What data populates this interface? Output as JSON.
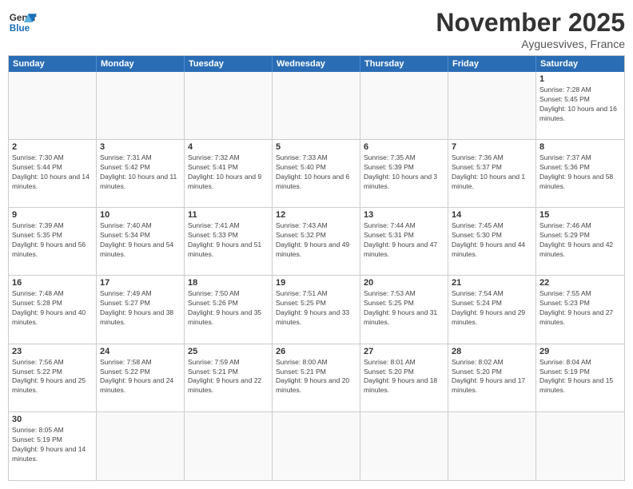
{
  "header": {
    "logo_general": "General",
    "logo_blue": "Blue",
    "month_title": "November 2025",
    "location": "Ayguesvives, France"
  },
  "day_headers": [
    "Sunday",
    "Monday",
    "Tuesday",
    "Wednesday",
    "Thursday",
    "Friday",
    "Saturday"
  ],
  "weeks": [
    [
      {
        "date": "",
        "info": ""
      },
      {
        "date": "",
        "info": ""
      },
      {
        "date": "",
        "info": ""
      },
      {
        "date": "",
        "info": ""
      },
      {
        "date": "",
        "info": ""
      },
      {
        "date": "",
        "info": ""
      },
      {
        "date": "1",
        "info": "Sunrise: 7:28 AM\nSunset: 5:45 PM\nDaylight: 10 hours and 16 minutes."
      }
    ],
    [
      {
        "date": "2",
        "info": "Sunrise: 7:30 AM\nSunset: 5:44 PM\nDaylight: 10 hours and 14 minutes."
      },
      {
        "date": "3",
        "info": "Sunrise: 7:31 AM\nSunset: 5:42 PM\nDaylight: 10 hours and 11 minutes."
      },
      {
        "date": "4",
        "info": "Sunrise: 7:32 AM\nSunset: 5:41 PM\nDaylight: 10 hours and 9 minutes."
      },
      {
        "date": "5",
        "info": "Sunrise: 7:33 AM\nSunset: 5:40 PM\nDaylight: 10 hours and 6 minutes."
      },
      {
        "date": "6",
        "info": "Sunrise: 7:35 AM\nSunset: 5:39 PM\nDaylight: 10 hours and 3 minutes."
      },
      {
        "date": "7",
        "info": "Sunrise: 7:36 AM\nSunset: 5:37 PM\nDaylight: 10 hours and 1 minute."
      },
      {
        "date": "8",
        "info": "Sunrise: 7:37 AM\nSunset: 5:36 PM\nDaylight: 9 hours and 58 minutes."
      }
    ],
    [
      {
        "date": "9",
        "info": "Sunrise: 7:39 AM\nSunset: 5:35 PM\nDaylight: 9 hours and 56 minutes."
      },
      {
        "date": "10",
        "info": "Sunrise: 7:40 AM\nSunset: 5:34 PM\nDaylight: 9 hours and 54 minutes."
      },
      {
        "date": "11",
        "info": "Sunrise: 7:41 AM\nSunset: 5:33 PM\nDaylight: 9 hours and 51 minutes."
      },
      {
        "date": "12",
        "info": "Sunrise: 7:43 AM\nSunset: 5:32 PM\nDaylight: 9 hours and 49 minutes."
      },
      {
        "date": "13",
        "info": "Sunrise: 7:44 AM\nSunset: 5:31 PM\nDaylight: 9 hours and 47 minutes."
      },
      {
        "date": "14",
        "info": "Sunrise: 7:45 AM\nSunset: 5:30 PM\nDaylight: 9 hours and 44 minutes."
      },
      {
        "date": "15",
        "info": "Sunrise: 7:46 AM\nSunset: 5:29 PM\nDaylight: 9 hours and 42 minutes."
      }
    ],
    [
      {
        "date": "16",
        "info": "Sunrise: 7:48 AM\nSunset: 5:28 PM\nDaylight: 9 hours and 40 minutes."
      },
      {
        "date": "17",
        "info": "Sunrise: 7:49 AM\nSunset: 5:27 PM\nDaylight: 9 hours and 38 minutes."
      },
      {
        "date": "18",
        "info": "Sunrise: 7:50 AM\nSunset: 5:26 PM\nDaylight: 9 hours and 35 minutes."
      },
      {
        "date": "19",
        "info": "Sunrise: 7:51 AM\nSunset: 5:25 PM\nDaylight: 9 hours and 33 minutes."
      },
      {
        "date": "20",
        "info": "Sunrise: 7:53 AM\nSunset: 5:25 PM\nDaylight: 9 hours and 31 minutes."
      },
      {
        "date": "21",
        "info": "Sunrise: 7:54 AM\nSunset: 5:24 PM\nDaylight: 9 hours and 29 minutes."
      },
      {
        "date": "22",
        "info": "Sunrise: 7:55 AM\nSunset: 5:23 PM\nDaylight: 9 hours and 27 minutes."
      }
    ],
    [
      {
        "date": "23",
        "info": "Sunrise: 7:56 AM\nSunset: 5:22 PM\nDaylight: 9 hours and 25 minutes."
      },
      {
        "date": "24",
        "info": "Sunrise: 7:58 AM\nSunset: 5:22 PM\nDaylight: 9 hours and 24 minutes."
      },
      {
        "date": "25",
        "info": "Sunrise: 7:59 AM\nSunset: 5:21 PM\nDaylight: 9 hours and 22 minutes."
      },
      {
        "date": "26",
        "info": "Sunrise: 8:00 AM\nSunset: 5:21 PM\nDaylight: 9 hours and 20 minutes."
      },
      {
        "date": "27",
        "info": "Sunrise: 8:01 AM\nSunset: 5:20 PM\nDaylight: 9 hours and 18 minutes."
      },
      {
        "date": "28",
        "info": "Sunrise: 8:02 AM\nSunset: 5:20 PM\nDaylight: 9 hours and 17 minutes."
      },
      {
        "date": "29",
        "info": "Sunrise: 8:04 AM\nSunset: 5:19 PM\nDaylight: 9 hours and 15 minutes."
      }
    ],
    [
      {
        "date": "30",
        "info": "Sunrise: 8:05 AM\nSunset: 5:19 PM\nDaylight: 9 hours and 14 minutes."
      },
      {
        "date": "",
        "info": ""
      },
      {
        "date": "",
        "info": ""
      },
      {
        "date": "",
        "info": ""
      },
      {
        "date": "",
        "info": ""
      },
      {
        "date": "",
        "info": ""
      },
      {
        "date": "",
        "info": ""
      }
    ]
  ]
}
